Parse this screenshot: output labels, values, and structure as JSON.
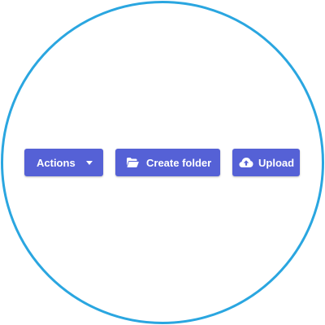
{
  "toolbar": {
    "actions_label": "Actions",
    "create_folder_label": "Create folder",
    "upload_label": "Upload"
  },
  "icons": {
    "actions": "caret-down-icon",
    "create_folder": "folder-open-icon",
    "upload": "cloud-upload-icon"
  },
  "colors": {
    "ring": "#2aa6e0",
    "button": "#5561d6",
    "button_text": "#ffffff"
  }
}
